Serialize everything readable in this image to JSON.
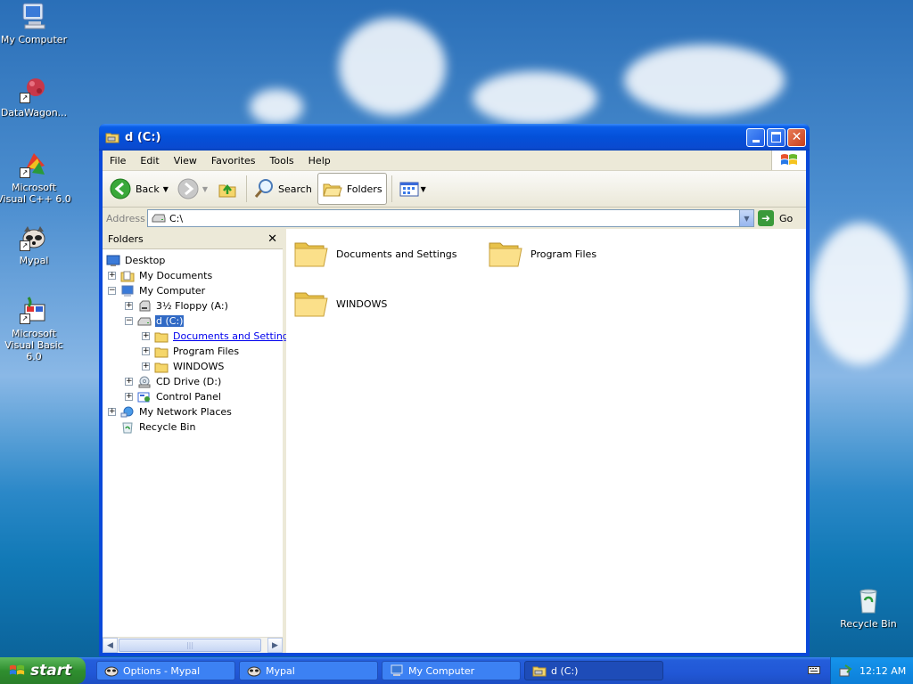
{
  "desktop": {
    "icons": [
      {
        "label": "My Computer"
      },
      {
        "label": "DataWagon..."
      },
      {
        "label": "Microsoft Visual C++ 6.0"
      },
      {
        "label": "Mypal"
      },
      {
        "label": "Microsoft Visual Basic 6.0"
      },
      {
        "label": "Recycle Bin"
      }
    ]
  },
  "window": {
    "title": "d (C:)",
    "menu": [
      "File",
      "Edit",
      "View",
      "Favorites",
      "Tools",
      "Help"
    ],
    "toolbar": {
      "back_label": "Back",
      "search_label": "Search",
      "folders_label": "Folders"
    },
    "address": {
      "label": "Address",
      "value": "C:\\",
      "go_label": "Go"
    },
    "folders_pane": {
      "title": "Folders",
      "tree": [
        {
          "label": "Desktop"
        },
        {
          "label": "My Documents"
        },
        {
          "label": "My Computer"
        },
        {
          "label": "3½ Floppy (A:)"
        },
        {
          "label": "d (C:)"
        },
        {
          "label": "Documents and Settings"
        },
        {
          "label": "Program Files"
        },
        {
          "label": "WINDOWS"
        },
        {
          "label": "CD Drive (D:)"
        },
        {
          "label": "Control Panel"
        },
        {
          "label": "My Network Places"
        },
        {
          "label": "Recycle Bin"
        }
      ]
    },
    "content": {
      "items": [
        {
          "label": "Documents and Settings"
        },
        {
          "label": "Program Files"
        },
        {
          "label": "WINDOWS"
        }
      ]
    }
  },
  "taskbar": {
    "start_label": "start",
    "tasks": [
      {
        "label": "Options - Mypal"
      },
      {
        "label": "Mypal"
      },
      {
        "label": "My Computer"
      },
      {
        "label": "d (C:)"
      }
    ],
    "clock": "12:12 AM"
  },
  "colors": {
    "titlebar": "#0450d8",
    "selection": "#316ac5",
    "link": "#0000ee"
  }
}
